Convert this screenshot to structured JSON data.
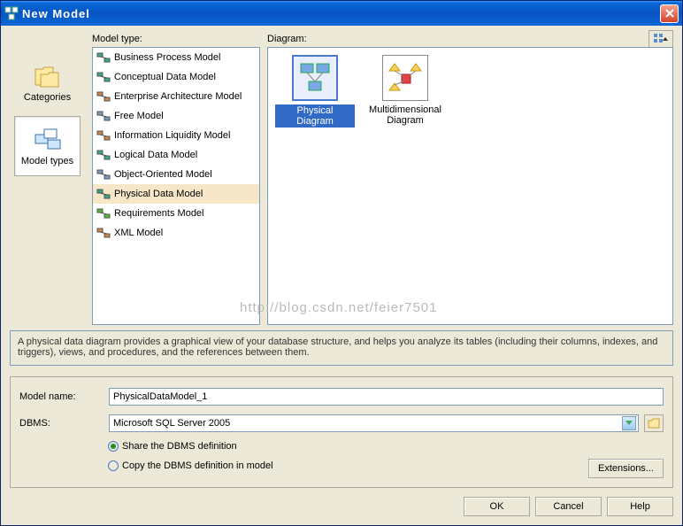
{
  "window": {
    "title": "New Model"
  },
  "sidebar": {
    "categories": {
      "label": "Categories"
    },
    "model_types": {
      "label": "Model types"
    }
  },
  "panels": {
    "model_type_label": "Model type:",
    "diagram_label": "Diagram:"
  },
  "model_types": [
    {
      "label": "Business Process Model"
    },
    {
      "label": "Conceptual Data Model"
    },
    {
      "label": "Enterprise Architecture Model"
    },
    {
      "label": "Free Model"
    },
    {
      "label": "Information Liquidity Model"
    },
    {
      "label": "Logical Data Model"
    },
    {
      "label": "Object-Oriented Model"
    },
    {
      "label": "Physical Data Model"
    },
    {
      "label": "Requirements Model"
    },
    {
      "label": "XML Model"
    }
  ],
  "selected_model_type_index": 7,
  "diagrams": [
    {
      "label": "Physical Diagram",
      "selected": true
    },
    {
      "label": "Multidimensional Diagram",
      "selected": false
    }
  ],
  "description": "A physical data diagram provides a graphical view of your database structure, and helps you analyze its tables (including their columns, indexes, and triggers), views, and procedures, and the references between them.",
  "form": {
    "model_name_label": "Model name:",
    "model_name_value": "PhysicalDataModel_1",
    "dbms_label": "DBMS:",
    "dbms_value": "Microsoft SQL Server 2005",
    "radio_share": "Share the DBMS definition",
    "radio_copy": "Copy the DBMS definition in model",
    "radio_selected": "share",
    "extensions_label": "Extensions..."
  },
  "buttons": {
    "ok": "OK",
    "cancel": "Cancel",
    "help": "Help"
  },
  "watermark": "http://blog.csdn.net/feier7501"
}
